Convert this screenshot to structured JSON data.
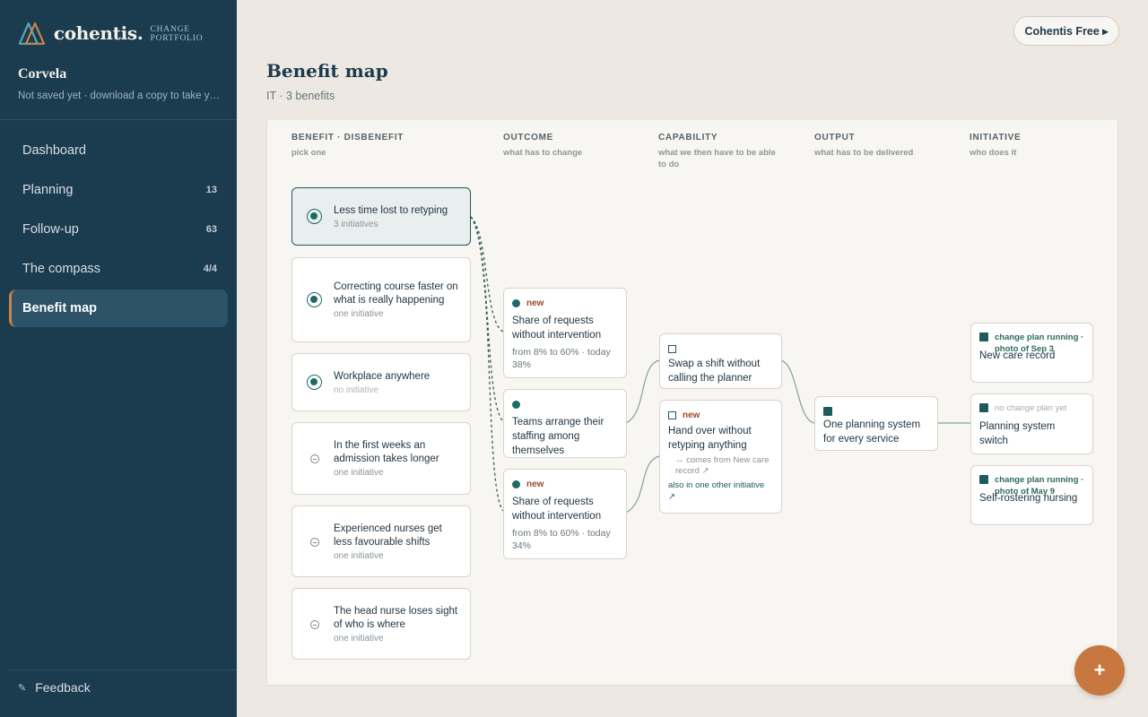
{
  "app": {
    "brand": "cohentis.",
    "tagline": "CHANGE PORTFOLIO",
    "org_name": "Corvela",
    "org_status": "Not saved yet · download a copy to take your work with you"
  },
  "nav": {
    "items": [
      {
        "label": "Dashboard",
        "count": ""
      },
      {
        "label": "Planning",
        "count": "13"
      },
      {
        "label": "Follow-up",
        "count": "63"
      },
      {
        "label": "The compass",
        "count": "4/4"
      },
      {
        "label": "Benefit map",
        "count": ""
      }
    ],
    "feedback": "Feedback"
  },
  "header": {
    "plan_button": "Cohentis Free ▸",
    "title": "Benefit map",
    "subtitle": "IT · 3 benefits"
  },
  "columns": [
    {
      "title": "BENEFIT · DISBENEFIT",
      "sub": "pick one"
    },
    {
      "title": "OUTCOME",
      "sub": "what has to change"
    },
    {
      "title": "CAPABILITY",
      "sub": "what we then have to be able to do"
    },
    {
      "title": "OUTPUT",
      "sub": "what has to be delivered"
    },
    {
      "title": "INITIATIVE",
      "sub": "who does it"
    }
  ],
  "benefits": [
    {
      "title": "Less time lost to retyping",
      "meta": "3 initiatives",
      "kind": "benefit",
      "selected": true
    },
    {
      "title": "Correcting course faster on what is really happening",
      "meta": "one initiative",
      "kind": "benefit",
      "selected": false
    },
    {
      "title": "Workplace anywhere",
      "meta": "no initiative",
      "kind": "benefit",
      "selected": false
    },
    {
      "title": "In the first weeks an admission takes longer",
      "meta": "one initiative",
      "kind": "disbenefit",
      "selected": false
    },
    {
      "title": "Experienced nurses get less favourable shifts",
      "meta": "one initiative",
      "kind": "disbenefit",
      "selected": false
    },
    {
      "title": "The head nurse loses sight of who is where",
      "meta": "one initiative",
      "kind": "disbenefit",
      "selected": false
    }
  ],
  "outcomes": [
    {
      "tag": "new",
      "title": "Share of requests without intervention",
      "detail": "from 8% to 60% · today 38%"
    },
    {
      "tag": "",
      "title": "Teams arrange their staffing among themselves",
      "detail": ""
    },
    {
      "tag": "new",
      "title": "Share of requests without intervention",
      "detail": "from 8% to 60% · today 34%"
    }
  ],
  "capabilities": [
    {
      "tag": "",
      "title": "Swap a shift without calling the planner",
      "from": "",
      "also": ""
    },
    {
      "tag": "new",
      "title": "Hand over without retyping anything",
      "from": "↔ comes from New care record ↗",
      "also": "also in one other initiative ↗"
    }
  ],
  "outputs": [
    {
      "title": "One planning system for every service"
    }
  ],
  "initiatives": [
    {
      "tag": "change plan running · photo of Sep 3",
      "title": "New care record",
      "running": true
    },
    {
      "tag": "no change plan yet",
      "title": "Planning system switch",
      "running": false
    },
    {
      "tag": "change plan running · photo of May 9",
      "title": "Self-rostering nursing",
      "running": true
    }
  ],
  "fab": {
    "label": "+"
  },
  "colors": {
    "sidebar": "#1b3b4e",
    "accent": "#c7773f",
    "teal": "#1e6a66",
    "background": "#ede8e1",
    "panel": "#f8f6f2"
  }
}
